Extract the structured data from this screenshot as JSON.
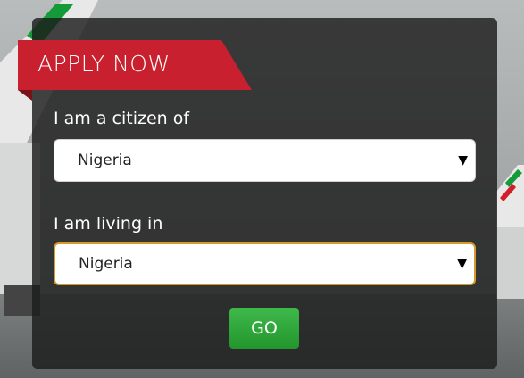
{
  "form": {
    "title": "APPLY NOW",
    "citizen_label": "I am a citizen of",
    "citizen_value": "Nigeria",
    "living_label": "I am living in",
    "living_value": "Nigeria",
    "go_label": "GO"
  },
  "icons": {
    "dropdown": "chevron-down-icon"
  },
  "colors": {
    "accent_red": "#c8202f",
    "go_green": "#2aa336",
    "focus_border": "#d59a2a"
  }
}
